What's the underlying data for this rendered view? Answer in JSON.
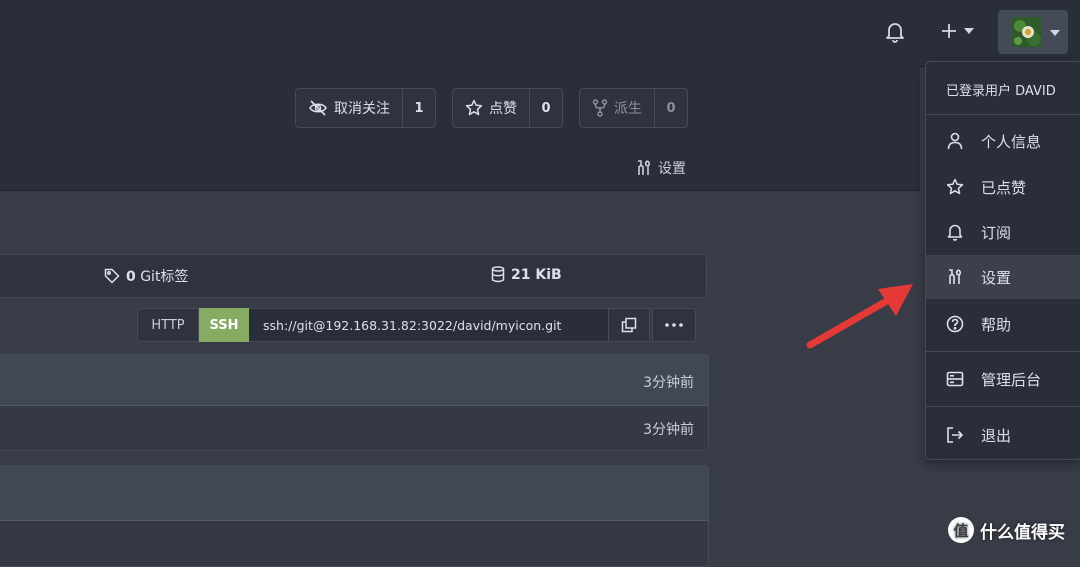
{
  "repo": {
    "unwatch_label": "取消关注",
    "watch_count": "1",
    "star_label": "点赞",
    "star_count": "0",
    "fork_label": "派生",
    "fork_count": "0",
    "settings_tab": "设置"
  },
  "stats": {
    "tags_count": "0",
    "tags_label": "Git标签",
    "size": "21 KiB"
  },
  "clone": {
    "http_label": "HTTP",
    "ssh_label": "SSH",
    "url": "ssh://git@192.168.31.82:3022/david/myicon.git"
  },
  "commits": [
    {
      "time": "3分钟前"
    },
    {
      "time": "3分钟前"
    }
  ],
  "user_menu": {
    "header": "已登录用户 DAVID",
    "items": [
      {
        "label": "个人信息",
        "icon": "person-icon"
      },
      {
        "label": "已点赞",
        "icon": "star-icon"
      },
      {
        "label": "订阅",
        "icon": "bell-icon"
      },
      {
        "label": "设置",
        "icon": "tools-icon"
      },
      {
        "label": "帮助",
        "icon": "question-icon"
      },
      {
        "label": "管理后台",
        "icon": "server-icon"
      },
      {
        "label": "退出",
        "icon": "sign-out-icon"
      }
    ],
    "active_item": "设置"
  },
  "watermark": {
    "logo_char": "值",
    "text": "什么值得买"
  },
  "colors": {
    "background": "#383c47",
    "navbar": "#2a2e3a",
    "ssh_active": "#87ab63",
    "arrow": "#e53935"
  }
}
